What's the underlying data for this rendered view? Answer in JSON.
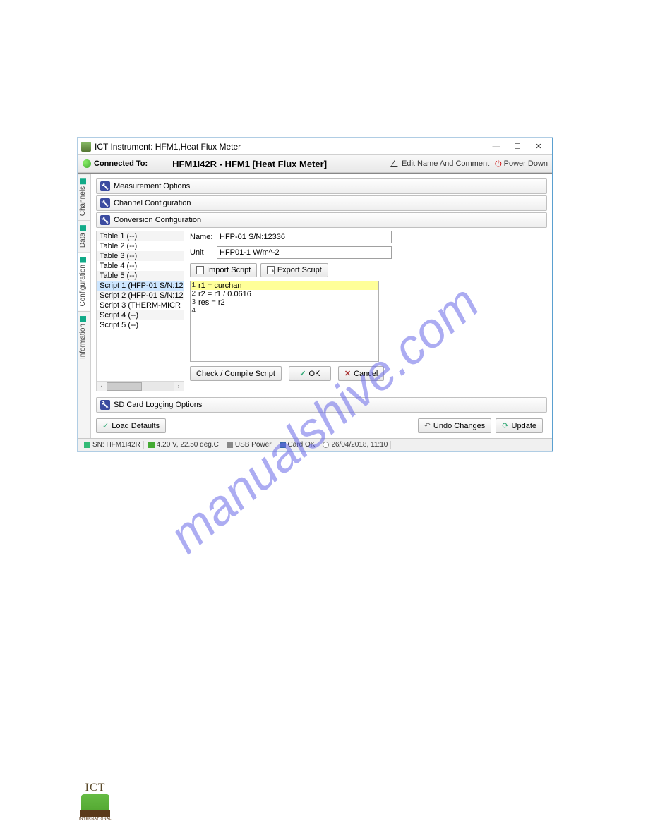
{
  "window": {
    "title": "ICT Instrument: HFM1,Heat Flux Meter"
  },
  "toolbar": {
    "connected_label": "Connected To:",
    "device_title": "HFM1I42R - HFM1 [Heat Flux Meter]",
    "edit_link": "Edit Name And Comment",
    "power_link": "Power Down"
  },
  "sidetabs": {
    "channels": "Channels",
    "data": "Data",
    "configuration": "Configuration",
    "information": "Information"
  },
  "accordions": {
    "measurement": "Measurement Options",
    "channel": "Channel Configuration",
    "conversion": "Conversion Configuration",
    "sd": "SD Card Logging Options"
  },
  "tree": [
    "Table 1 (--)",
    "Table 2 (--)",
    "Table 3 (--)",
    "Table 4 (--)",
    "Table 5 (--)",
    "Script 1 (HFP-01 S/N:12",
    "Script 2 (HFP-01 S/N:12",
    "Script 3 (THERM-MICR",
    "Script 4 (--)",
    "Script 5 (--)"
  ],
  "tree_selected_index": 5,
  "form": {
    "name_label": "Name:",
    "name_value": "HFP-01 S/N:12336",
    "unit_label": "Unit",
    "unit_value": "HFP01-1 W/m^-2"
  },
  "buttons": {
    "import": "Import Script",
    "export": "Export Script",
    "check": "Check / Compile Script",
    "ok": "OK",
    "cancel": "Cancel",
    "load_defaults": "Load Defaults",
    "undo": "Undo Changes",
    "update": "Update"
  },
  "script_lines": [
    {
      "n": "1",
      "t": "r1 = curchan",
      "hl": true
    },
    {
      "n": "2",
      "t": "r2 = r1 / 0.0616",
      "hl": false
    },
    {
      "n": "3",
      "t": "res = r2",
      "hl": false
    },
    {
      "n": "4",
      "t": "",
      "hl": false
    }
  ],
  "status": {
    "sn": "SN: HFM1I42R",
    "batt": "4.20 V, 22.50 deg.C",
    "usb": "USB Power",
    "card": "Card OK",
    "time": "26/04/2018, 11:10"
  },
  "watermark": "manualshive.com",
  "footer": {
    "brand": "ICT",
    "intl": "INTERNATIONAL"
  }
}
